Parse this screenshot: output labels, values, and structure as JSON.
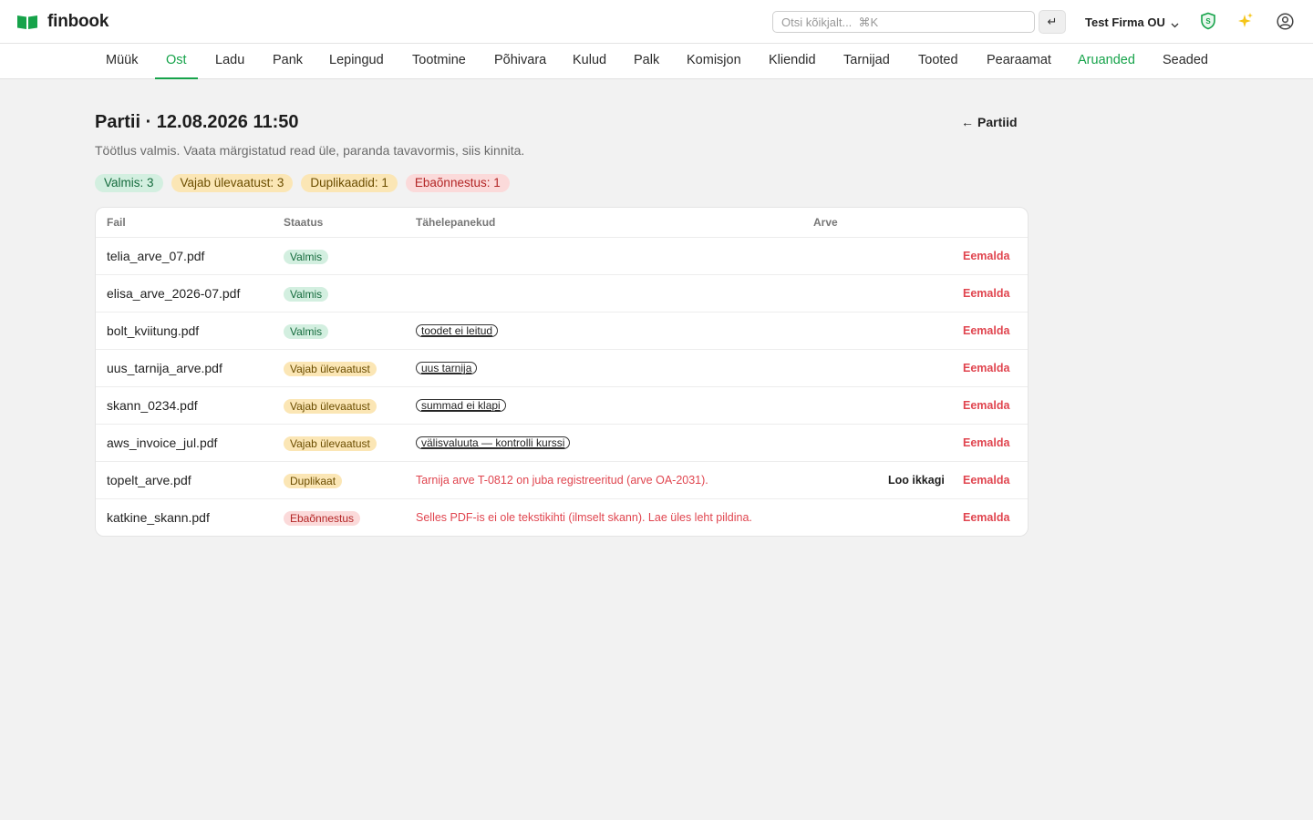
{
  "app": {
    "name": "finbook",
    "search_placeholder": "Otsi kõikjalt...  ⌘K",
    "enter_symbol": "↵",
    "company": "Test Firma OU",
    "icons": [
      "book-logo-icon",
      "shield-s-icon",
      "sparkles-icon",
      "user-circle-icon",
      "chevron-down-icon"
    ],
    "colors": {
      "accent": "#16a34a",
      "danger": "#e0454f",
      "ok_bg": "#d3efe0",
      "warn_bg": "#fbe6b5",
      "err_bg": "#fbdada"
    }
  },
  "nav": {
    "items": [
      {
        "label": "Müük"
      },
      {
        "label": "Ost"
      },
      {
        "label": "Ladu"
      },
      {
        "label": "Pank"
      },
      {
        "label": "Lepingud"
      },
      {
        "label": "Tootmine"
      },
      {
        "label": "Põhivara"
      },
      {
        "label": "Kulud"
      },
      {
        "label": "Palk"
      },
      {
        "label": "Komisjon"
      },
      {
        "label": "Kliendid"
      },
      {
        "label": "Tarnijad"
      },
      {
        "label": "Tooted"
      },
      {
        "label": "Pearaamat"
      },
      {
        "label": "Aruanded"
      },
      {
        "label": "Seaded"
      }
    ],
    "active": "Ost"
  },
  "page": {
    "title": "Partii · 12.08.2026 11:50",
    "subtitle": "Töötlus valmis. Vaata märgistatud read üle, paranda tavavormis, siis kinnita.",
    "back_label": "Partiid",
    "back_arrow": "←"
  },
  "summary": {
    "done": "Valmis: 3",
    "review": "Vajab ülevaatust: 3",
    "duplicates": "Duplikaadid: 1",
    "failed": "Ebaõnnestus: 1"
  },
  "table": {
    "headers": {
      "file": "Fail",
      "status": "Staatus",
      "notes": "Tähelepanekud",
      "invoice": "Arve"
    },
    "remove_label": "Eemalda",
    "create_anyway_label": "Loo ikkagi",
    "rows": [
      {
        "file": "telia_arve_07.pdf",
        "status": "Valmis",
        "note": ""
      },
      {
        "file": "elisa_arve_2026-07.pdf",
        "status": "Valmis",
        "note": ""
      },
      {
        "file": "bolt_kviitung.pdf",
        "status": "Valmis",
        "note": "toodet ei leitud"
      },
      {
        "file": "uus_tarnija_arve.pdf",
        "status": "Vajab ülevaatust",
        "note": "uus tarnija"
      },
      {
        "file": "skann_0234.pdf",
        "status": "Vajab ülevaatust",
        "note": "summad ei klapi"
      },
      {
        "file": "aws_invoice_jul.pdf",
        "status": "Vajab ülevaatust",
        "note": "välisvaluuta — kontrolli kurssi"
      },
      {
        "file": "topelt_arve.pdf",
        "status": "Duplikaat",
        "note": "Tarnija arve T-0812 on juba registreeritud (arve OA-2031)."
      },
      {
        "file": "katkine_skann.pdf",
        "status": "Ebaõnnestus",
        "note": "Selles PDF-is ei ole tekstikihti (ilmselt skann). Lae üles leht pildina."
      }
    ]
  }
}
